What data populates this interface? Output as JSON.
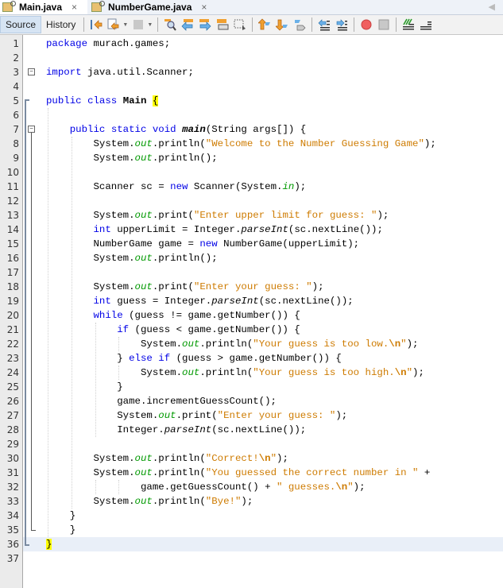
{
  "tabs": [
    {
      "label": "Main.java",
      "active": true,
      "close": "×"
    },
    {
      "label": "NumberGame.java",
      "active": false,
      "close": "×"
    }
  ],
  "toolbar": {
    "source_label": "Source",
    "history_label": "History",
    "icons": [
      "last-edit-icon",
      "back-icon",
      "forward-icon",
      "find-icon",
      "find-previous-icon",
      "find-next-icon",
      "toggle-highlight-icon",
      "toggle-rect-selection-icon",
      "previous-bookmark-icon",
      "next-bookmark-icon",
      "toggle-bookmark-icon",
      "shift-left-icon",
      "shift-right-icon",
      "start-macro-icon",
      "stop-macro-icon",
      "comment-icon",
      "uncomment-icon"
    ]
  },
  "editor": {
    "current_line": 36,
    "lines": [
      {
        "n": "1",
        "html": "<span class='kw'>package</span> murach.games;"
      },
      {
        "n": "2",
        "html": ""
      },
      {
        "n": "3",
        "html": "<span class='kw'>import</span> java.util.Scanner;"
      },
      {
        "n": "4",
        "html": ""
      },
      {
        "n": "5",
        "html": "<span class='kw'>public</span> <span class='kw'>class</span> <span class='bold'>Main</span> <span class='hl'>{</span>"
      },
      {
        "n": "6",
        "html": ""
      },
      {
        "n": "7",
        "html": "    <span class='kw'>public</span> <span class='kw'>static</span> <span class='kw'>void</span> <span class='bold ital'>main</span>(String args[]) {"
      },
      {
        "n": "8",
        "html": "        System.<span class='fld'>out</span>.println(<span class='str'>\"Welcome to the Number Guessing Game\"</span>);"
      },
      {
        "n": "9",
        "html": "        System.<span class='fld'>out</span>.println();"
      },
      {
        "n": "10",
        "html": ""
      },
      {
        "n": "11",
        "html": "        Scanner sc = <span class='kw'>new</span> Scanner(System.<span class='fld'>in</span>);"
      },
      {
        "n": "12",
        "html": ""
      },
      {
        "n": "13",
        "html": "        System.<span class='fld'>out</span>.print(<span class='str'>\"Enter upper limit for guess: \"</span>);"
      },
      {
        "n": "14",
        "html": "        <span class='kw'>int</span> upperLimit = Integer.<span class='ital'>parseInt</span>(sc.nextLine());"
      },
      {
        "n": "15",
        "html": "        NumberGame game = <span class='kw'>new</span> NumberGame(upperLimit);"
      },
      {
        "n": "16",
        "html": "        System.<span class='fld'>out</span>.println();"
      },
      {
        "n": "17",
        "html": ""
      },
      {
        "n": "18",
        "html": "        System.<span class='fld'>out</span>.print(<span class='str'>\"Enter your guess: \"</span>);"
      },
      {
        "n": "19",
        "html": "        <span class='kw'>int</span> guess = Integer.<span class='ital'>parseInt</span>(sc.nextLine());"
      },
      {
        "n": "20",
        "html": "        <span class='kw'>while</span> (guess != game.getNumber()) {"
      },
      {
        "n": "21",
        "html": "            <span class='kw'>if</span> (guess &lt; game.getNumber()) {"
      },
      {
        "n": "22",
        "html": "                System.<span class='fld'>out</span>.println(<span class='str'>\"Your guess is too low.<b>\\n</b>\"</span>);"
      },
      {
        "n": "23",
        "html": "            } <span class='kw'>else</span> <span class='kw'>if</span> (guess &gt; game.getNumber()) {"
      },
      {
        "n": "24",
        "html": "                System.<span class='fld'>out</span>.println(<span class='str'>\"Your guess is too high.<b>\\n</b>\"</span>);"
      },
      {
        "n": "25",
        "html": "            }"
      },
      {
        "n": "26",
        "html": "            game.incrementGuessCount();"
      },
      {
        "n": "27",
        "html": "            System.<span class='fld'>out</span>.print(<span class='str'>\"Enter your guess: \"</span>);"
      },
      {
        "n": "28",
        "html": "            Integer.<span class='ital'>parseInt</span>(sc.nextLine());"
      },
      {
        "n": "29",
        "html": ""
      },
      {
        "n": "30",
        "html": "        System.<span class='fld'>out</span>.println(<span class='str'>\"Correct!<b>\\n</b>\"</span>);"
      },
      {
        "n": "31",
        "html": "        System.<span class='fld'>out</span>.println(<span class='str'>\"You guessed the correct number in \"</span> +"
      },
      {
        "n": "32",
        "html": "                game.getGuessCount() + <span class='str'>\" guesses.<b>\\n</b>\"</span>);"
      },
      {
        "n": "33",
        "html": "        System.<span class='fld'>out</span>.println(<span class='str'>\"Bye!\"</span>);"
      },
      {
        "n": "34",
        "html": "    }"
      },
      {
        "n": "35",
        "html": "    }"
      },
      {
        "n": "36",
        "html": "<span class='hl'>}</span>"
      },
      {
        "n": "37",
        "html": ""
      }
    ]
  }
}
